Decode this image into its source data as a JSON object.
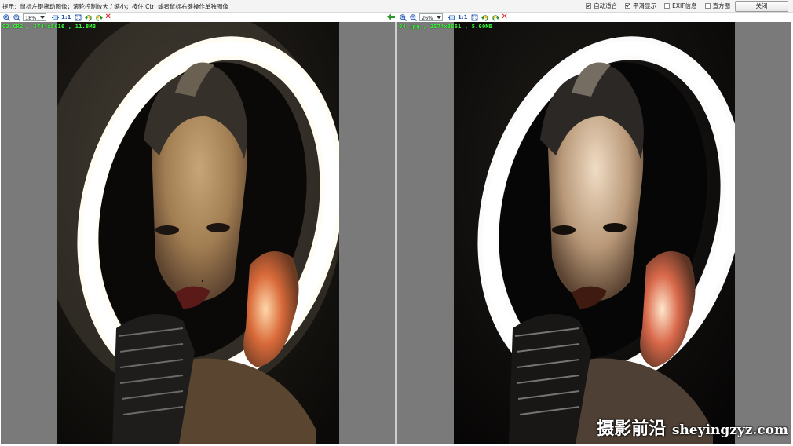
{
  "topbar": {
    "hint": "提示：鼠标左键拖动图像；滚轮控制放大 / 缩小；按住 Ctrl 或者鼠标右键操作单独图像",
    "options": [
      {
        "label": "自动适合",
        "checked": true
      },
      {
        "label": "平滑显示",
        "checked": true
      },
      {
        "label": "EXIF信息",
        "checked": false
      },
      {
        "label": "直方图",
        "checked": false
      }
    ],
    "close_label": "关闭"
  },
  "left_pane": {
    "zoom": "18%",
    "one_to_one": "1:1",
    "info": "03.CR2 , 3744x5616 , 11.8MB"
  },
  "right_pane": {
    "zoom": "26%",
    "one_to_one": "1:1",
    "info": "04.jpg , 2574x3861 , 5.00MB"
  },
  "watermark": {
    "cn": "摄影前沿",
    "latin": "sheyingzyz.com"
  },
  "colors": {
    "info_text": "#3cff3c",
    "pane_bg": "#7a7a7a",
    "delete_x": "#dd2222"
  }
}
